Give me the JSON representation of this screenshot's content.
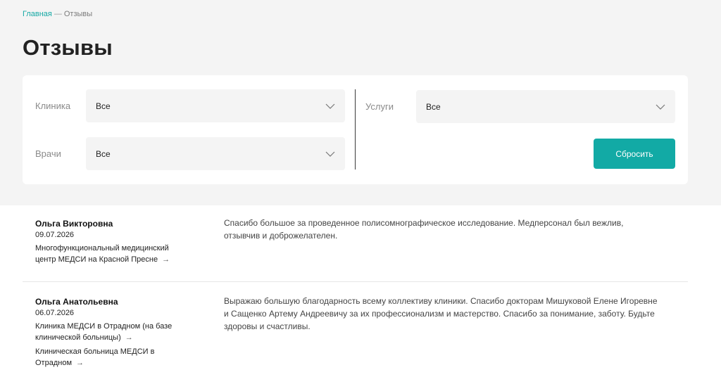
{
  "breadcrumb": {
    "home": "Главная",
    "separator": "—",
    "current": "Отзывы"
  },
  "page_title": "Отзывы",
  "filters": {
    "clinic": {
      "label": "Клиника",
      "value": "Все"
    },
    "doctors": {
      "label": "Врачи",
      "value": "Все"
    },
    "services": {
      "label": "Услуги",
      "value": "Все"
    },
    "reset_label": "Сбросить"
  },
  "reviews": [
    {
      "name": "Ольга Викторовна",
      "date": "09.07.2026",
      "clinics": [
        "Многофункциональный медицинский центр МЕДСИ на Красной Пресне"
      ],
      "text": "Спасибо большое за проведенное полисомнографическое исследование. Медперсонал был вежлив, отзывчив и доброжелателен."
    },
    {
      "name": "Ольга Анатольевна",
      "date": "06.07.2026",
      "clinics": [
        "Клиника МЕДСИ в Отрадном (на базе клинической больницы)",
        "Клиническая больница МЕДСИ в Отрадном"
      ],
      "text": "Выражаю большую благодарность всему коллективу клиники. Спасибо докторам Мишуковой Елене Игоревне и Сащенко Артему Андреевичу за их профессионализм и мастерство. Спасибо за понимание, заботу. Будьте здоровы и счастливы."
    }
  ],
  "icons": {
    "dropdown": "chevron-down-icon",
    "link": "arrow-right-icon"
  },
  "colors": {
    "accent": "#12aaa5",
    "background": "#f4f4f4"
  }
}
